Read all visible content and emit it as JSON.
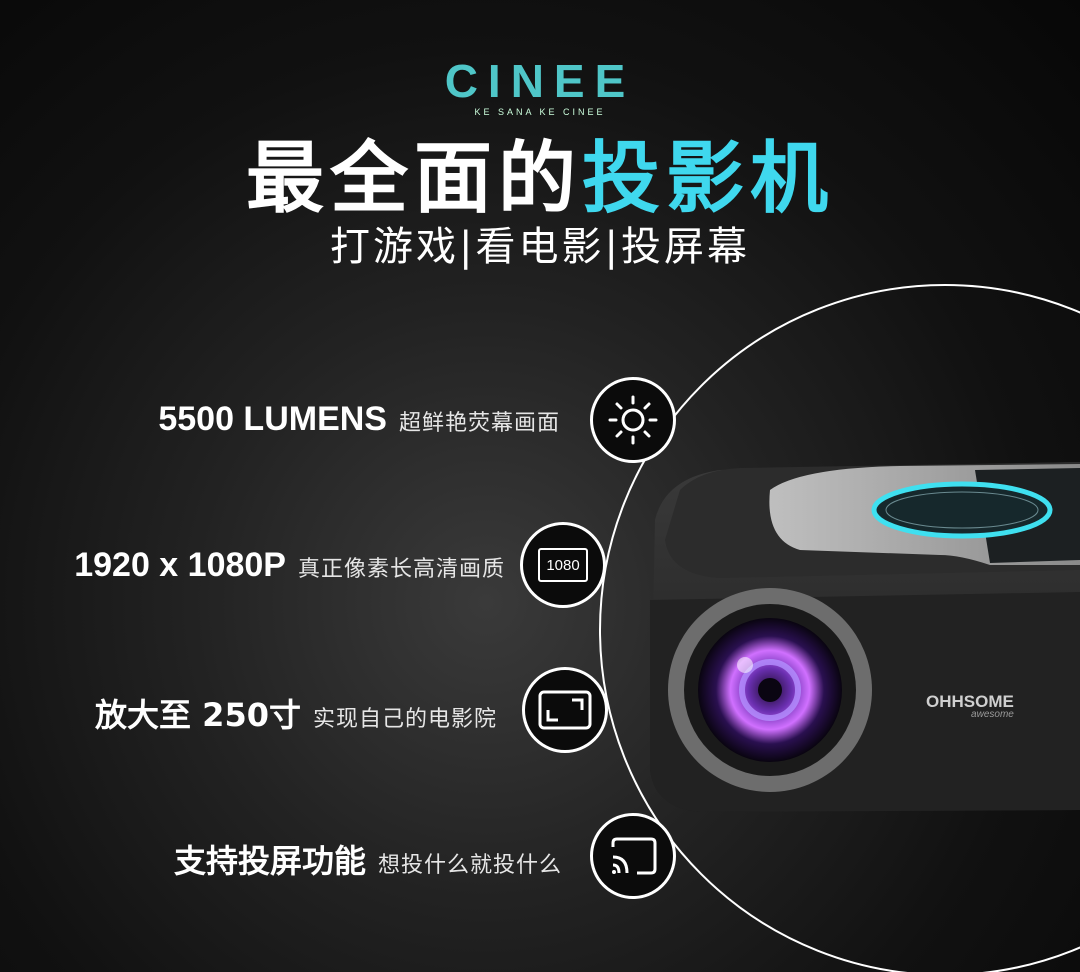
{
  "brand": {
    "name": "CINEE",
    "tagline": "KE SANA KE CINEE"
  },
  "headline": {
    "part1": "最全面的",
    "part2": "投影机"
  },
  "subhead": "打游戏|看电影|投屏幕",
  "features": [
    {
      "main": "5500 LUMENS",
      "sub": "超鲜艳荧幕画面",
      "icon": "brightness-icon"
    },
    {
      "main": "1920 x 1080P",
      "sub": "真正像素长高清画质",
      "icon": "resolution-1080-icon",
      "icon_text": "1080"
    },
    {
      "main": "放大至 250寸",
      "sub": "实现自己的电影院",
      "icon": "screen-expand-icon"
    },
    {
      "main": "支持投屏功能",
      "sub": "想投什么就投什么",
      "icon": "cast-icon"
    }
  ],
  "product": {
    "brand_label": "OHHSOME",
    "brand_sub": "awesome"
  },
  "colors": {
    "accent": "#3fd8ee",
    "logo": "#4fc6c8",
    "ring": "#3fe0f0"
  }
}
